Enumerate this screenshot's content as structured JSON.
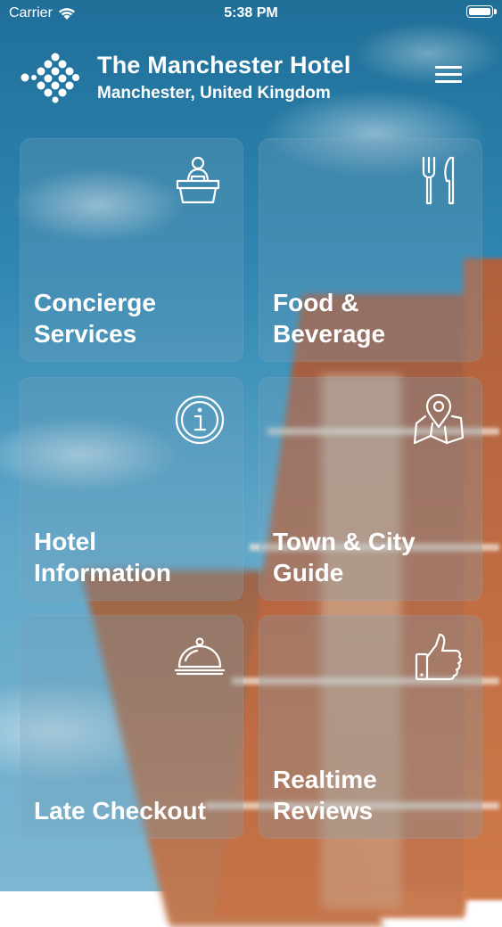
{
  "status_bar": {
    "carrier": "Carrier",
    "time": "5:38 PM",
    "wifi_icon": "wifi-icon",
    "battery_icon": "battery-icon"
  },
  "header": {
    "logo_icon": "hotel-logo-icon",
    "hotel_name": "The Manchester Hotel",
    "location": "Manchester, United Kingdom",
    "menu_icon": "hamburger-menu-icon"
  },
  "tiles": [
    {
      "label": "Concierge\nServices",
      "icon": "concierge-desk-icon"
    },
    {
      "label": "Food & Beverage",
      "icon": "fork-knife-icon"
    },
    {
      "label": "Hotel\nInformation",
      "icon": "info-icon"
    },
    {
      "label": "Town & City\nGuide",
      "icon": "map-pin-icon"
    },
    {
      "label": "Late Checkout",
      "icon": "cloche-icon"
    },
    {
      "label": "Realtime\nReviews",
      "icon": "thumbs-up-icon"
    }
  ],
  "colors": {
    "text": "#ffffff",
    "tile_background": "rgba(120,160,185,0.28)",
    "sky": "#2f87b2",
    "brick": "#b8643f"
  }
}
